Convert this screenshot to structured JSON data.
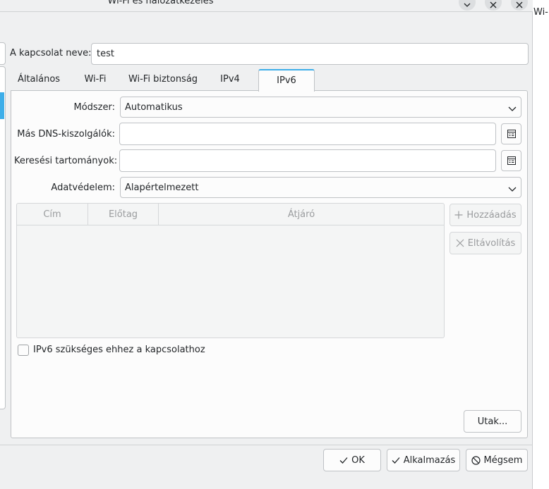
{
  "window": {
    "title": "Wi-Fi és hálózatkezelés",
    "side_title": "Wi-F"
  },
  "connection": {
    "name_label": "A kapcsolat neve:",
    "name_value": "test"
  },
  "tabs": [
    {
      "label": "Általános"
    },
    {
      "label": "Wi-Fi"
    },
    {
      "label": "Wi-Fi biztonság"
    },
    {
      "label": "IPv4"
    },
    {
      "label": "IPv6",
      "active": true
    }
  ],
  "ipv6": {
    "method_label": "Módszer:",
    "method_value": "Automatikus",
    "dns_label": "Más DNS-kiszolgálók:",
    "dns_value": "",
    "search_label": "Keresési tartományok:",
    "search_value": "",
    "privacy_label": "Adatvédelem:",
    "privacy_value": "Alapértelmezett",
    "table": {
      "columns": [
        "Cím",
        "Előtag",
        "Átjáró"
      ],
      "rows": []
    },
    "add_button": "Hozzáadás",
    "remove_button": "Eltávolítás",
    "required_checkbox_label": "IPv6 szükséges ehhez a kapcsolathoz",
    "required_checked": false,
    "routes_button": "Utak..."
  },
  "footer": {
    "ok": "OK",
    "apply": "Alkalmazás",
    "cancel": "Mégsem"
  },
  "colors": {
    "accent": "#3daee9",
    "window_bg": "#eff0f1",
    "border": "#bfc2c5",
    "disabled_text": "#9a9c9e"
  }
}
